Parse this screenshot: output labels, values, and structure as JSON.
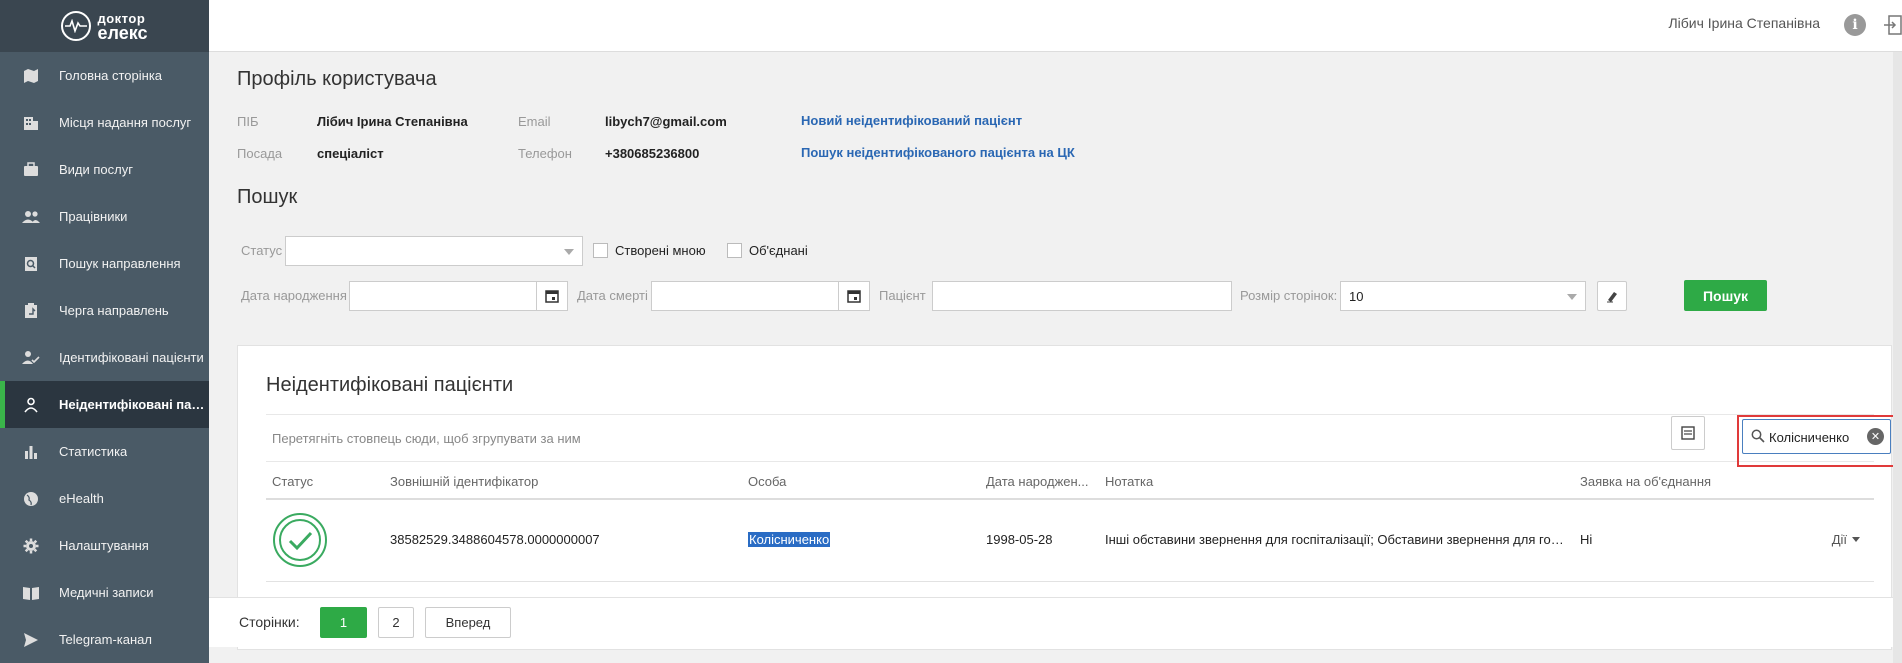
{
  "brand": {
    "line1": "доктор",
    "line2": "елекс"
  },
  "sidebar": {
    "items": [
      {
        "label": "Головна сторінка",
        "icon": "map-icon",
        "active": false
      },
      {
        "label": "Місця надання послуг",
        "icon": "building-icon",
        "active": false
      },
      {
        "label": "Види послуг",
        "icon": "briefcase-icon",
        "active": false
      },
      {
        "label": "Працівники",
        "icon": "people-icon",
        "active": false
      },
      {
        "label": "Пошук направлення",
        "icon": "search-document-icon",
        "active": false
      },
      {
        "label": "Черга направлень",
        "icon": "queue-icon",
        "active": false
      },
      {
        "label": "Ідентифіковані пацієнти",
        "icon": "user-check-icon",
        "active": false
      },
      {
        "label": "Неідентифіковані пацієнти",
        "icon": "user-icon",
        "active": true
      },
      {
        "label": "Статистика",
        "icon": "bar-chart-icon",
        "active": false
      },
      {
        "label": "eHealth",
        "icon": "globe-icon",
        "active": false
      },
      {
        "label": "Налаштування",
        "icon": "gear-icon",
        "active": false
      },
      {
        "label": "Медичні записи",
        "icon": "book-icon",
        "active": false
      },
      {
        "label": "Telegram-канал",
        "icon": "send-icon",
        "active": false
      }
    ]
  },
  "header": {
    "user_name": "Лібич Ірина Степанівна"
  },
  "profile": {
    "title": "Профіль користувача",
    "pib_label": "ПІБ",
    "pib_value": "Лібич Ірина Степанівна",
    "position_label": "Посада",
    "position_value": "спеціаліст",
    "email_label": "Email",
    "email_value": "libych7@gmail.com",
    "phone_label": "Телефон",
    "phone_value": "+380685236800",
    "link_new": "Новий неідентифікований пацієнт",
    "link_search": "Пошук неідентифікованого пацієнта на ЦК"
  },
  "search": {
    "title": "Пошук",
    "status_label": "Статус",
    "status_value": "",
    "created_by_me_label": "Створені мною",
    "merged_label": "Об'єднані",
    "birth_label": "Дата народження",
    "death_label": "Дата смерті",
    "patient_label": "Пацієнт",
    "page_size_label": "Розмір сторінок:",
    "page_size_value": "10",
    "search_button": "Пошук"
  },
  "table_card": {
    "title": "Неідентифіковані пацієнти",
    "group_hint": "Перетягніть стовпець сюди, щоб згрупувати за ним",
    "search_value": "Колісниченко",
    "columns": [
      "Статус",
      "Зовнішній ідентифікатор",
      "Особа",
      "Дата народжен...",
      "Нотатка",
      "Заявка на об'єднання"
    ],
    "rows": [
      {
        "external_id": "38582529.3488604578.0000000007",
        "person": "Колісниченко",
        "birth_date": "1998-05-28",
        "note": "Інші обставини звернення для госпіталізації; Обставини звернення для госпіталізації",
        "merge_request": "Ні",
        "actions": "Дії"
      }
    ]
  },
  "pager": {
    "label": "Сторінки:",
    "pages": [
      "1",
      "2"
    ],
    "next": "Вперед"
  },
  "colors": {
    "accent_green": "#2eaa46",
    "sidebar_bg": "#4a5a66",
    "link_blue": "#2a67b3",
    "highlight_red": "#e03a3a"
  }
}
